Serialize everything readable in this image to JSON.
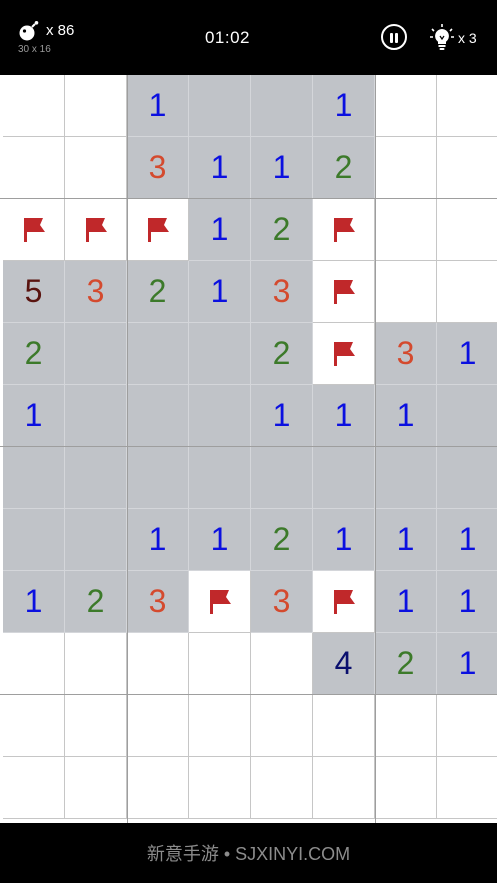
{
  "header": {
    "mines_remaining": "x 86",
    "board_size": "30 x 16",
    "timer": "01:02",
    "hints_remaining": "x 3"
  },
  "board": {
    "number_colors": {
      "1": "#0b10e0",
      "2": "#3c7a2a",
      "3": "#d44a2e",
      "4": "#0a0f6e",
      "5": "#5a1410"
    },
    "flag_color": "#c0282a",
    "rows": [
      [
        "",
        "",
        "1",
        "0",
        "0",
        "1",
        "",
        ""
      ],
      [
        "",
        "",
        "3",
        "1",
        "1",
        "2",
        "",
        ""
      ],
      [
        "F",
        "F",
        "F",
        "1",
        "2",
        "F",
        "",
        ""
      ],
      [
        "5",
        "3",
        "2",
        "1",
        "3",
        "F",
        "",
        ""
      ],
      [
        "2",
        "0",
        "0",
        "0",
        "2",
        "F",
        "3",
        "1"
      ],
      [
        "1",
        "0",
        "0",
        "0",
        "1",
        "1",
        "1",
        "0"
      ],
      [
        "0",
        "0",
        "0",
        "0",
        "0",
        "0",
        "0",
        "0"
      ],
      [
        "0",
        "0",
        "1",
        "1",
        "2",
        "1",
        "1",
        "1"
      ],
      [
        "1",
        "2",
        "3",
        "F",
        "3",
        "F",
        "1",
        "1"
      ],
      [
        "",
        "",
        "",
        "",
        "",
        "4",
        "2",
        "1"
      ],
      [
        "",
        "",
        "",
        "",
        "",
        "",
        "",
        ""
      ],
      [
        "",
        "",
        "",
        "",
        "",
        "",
        "",
        ""
      ]
    ]
  },
  "footer": {
    "watermark": "新意手游 • SJXINYI.COM"
  }
}
